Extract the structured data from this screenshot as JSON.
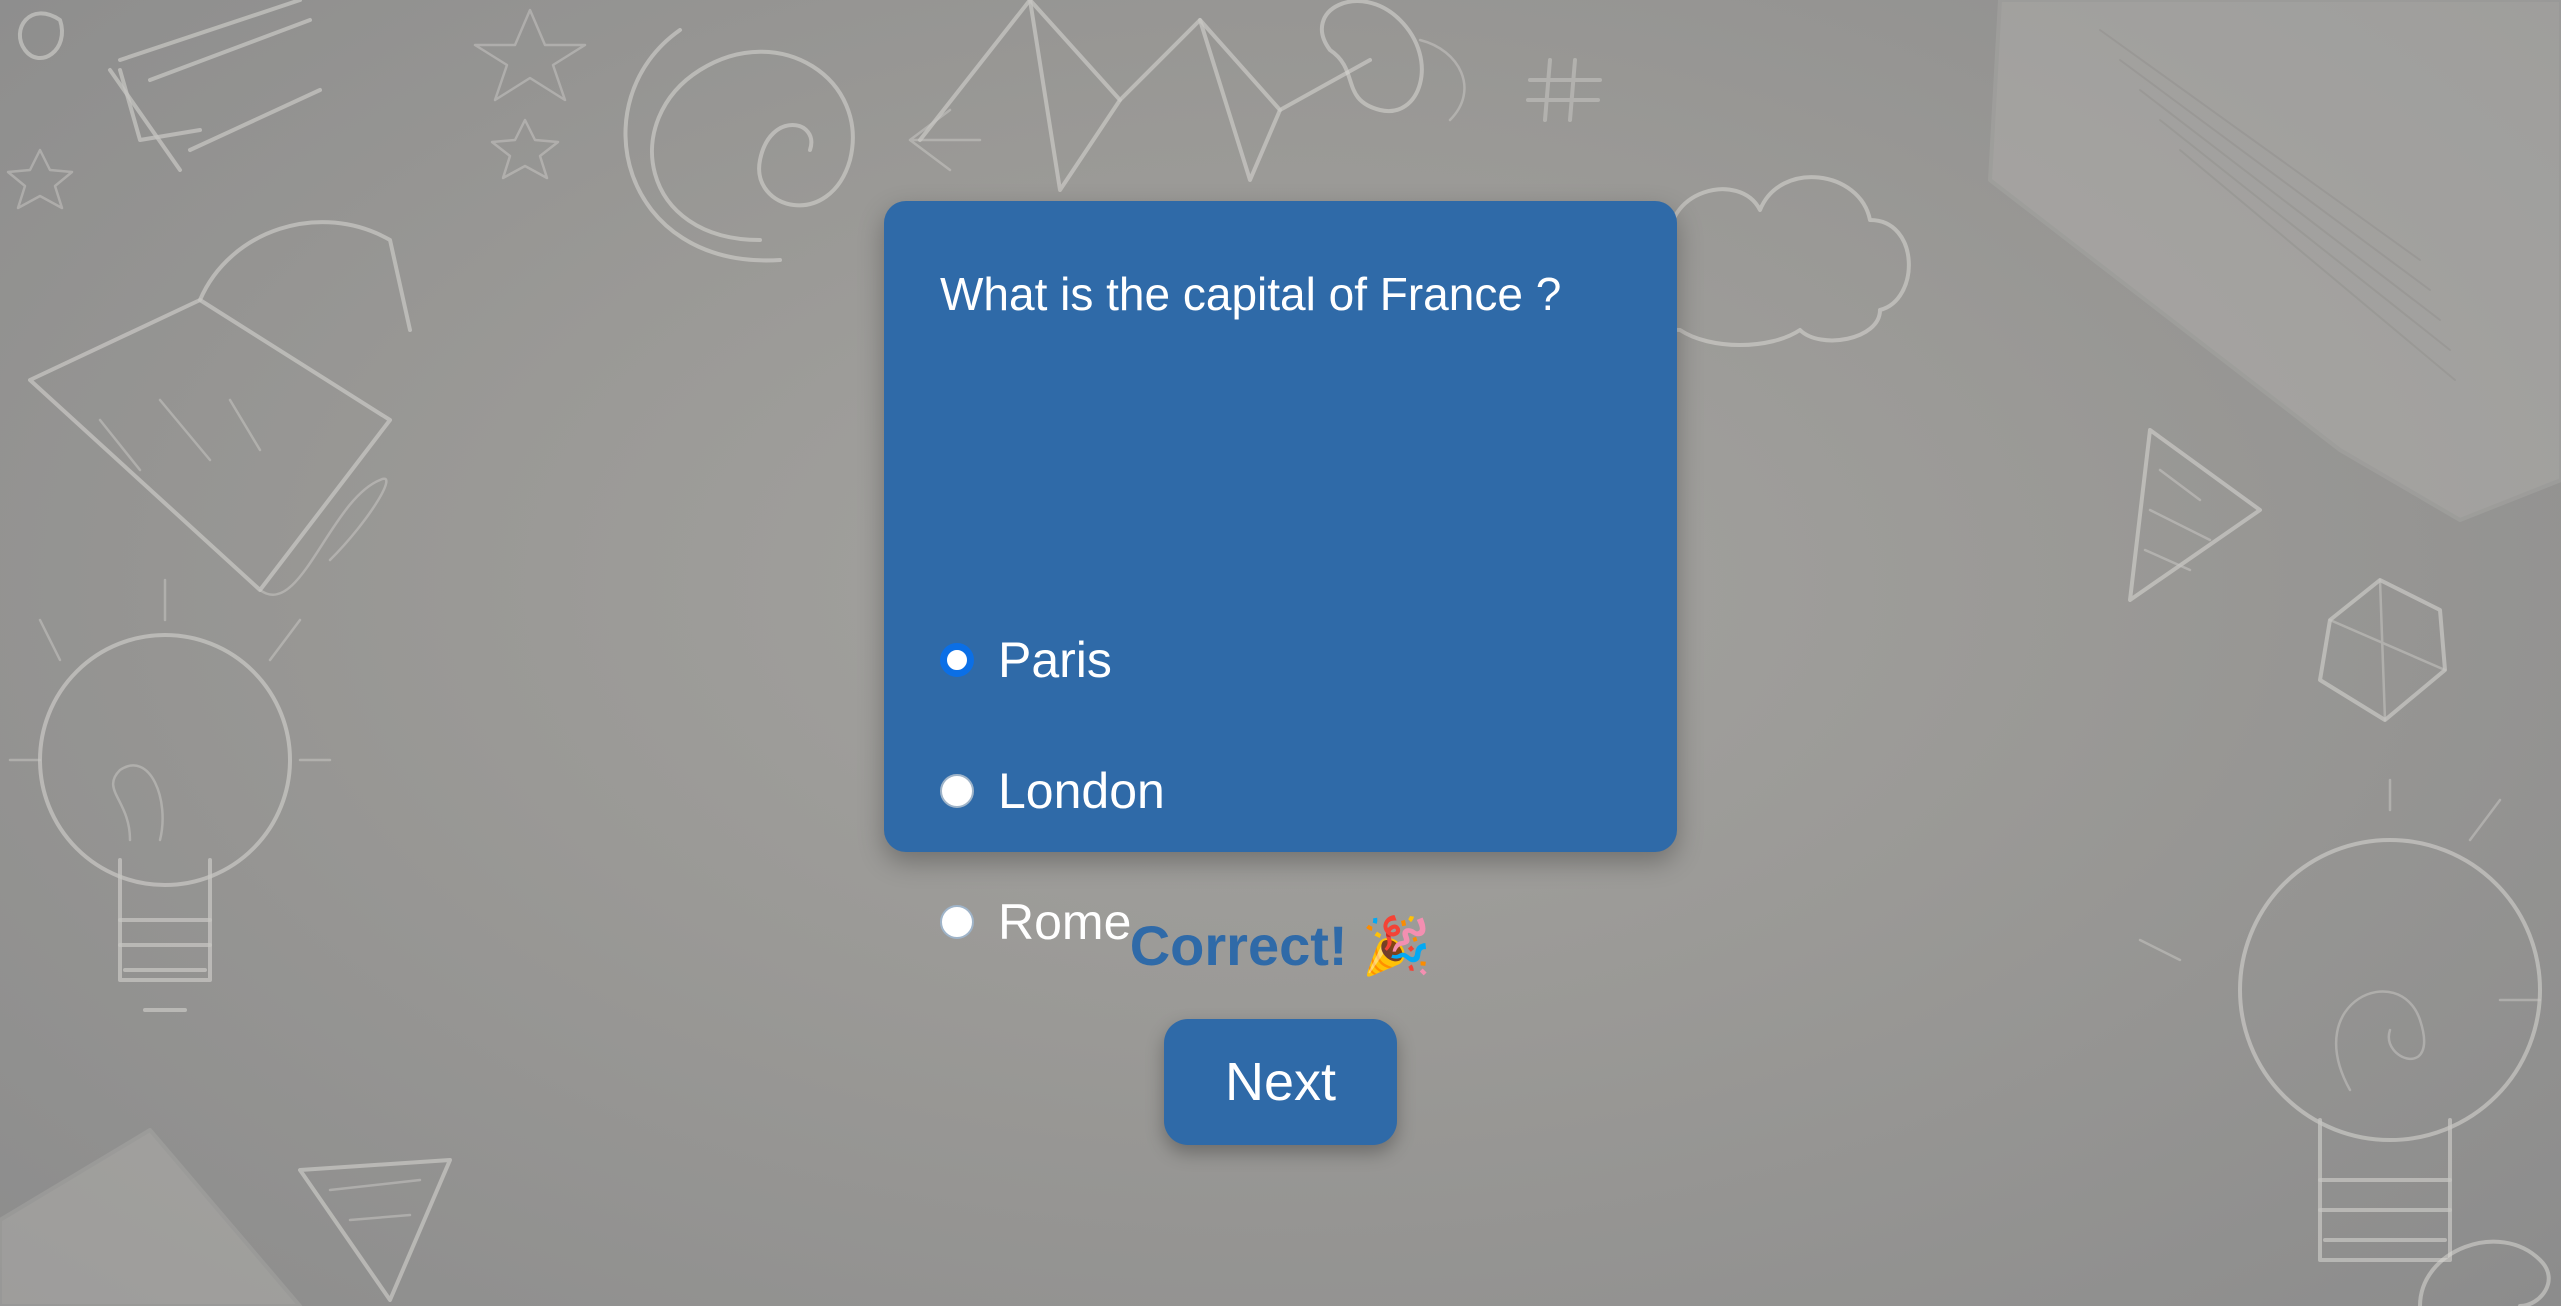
{
  "quiz": {
    "question": "What is the capital of France ?",
    "selected_option": "Paris",
    "options": [
      {
        "label": "Paris",
        "checked": true
      },
      {
        "label": "London",
        "checked": false
      },
      {
        "label": "Rome",
        "checked": false
      }
    ]
  },
  "feedback": {
    "text": "Correct!",
    "emoji": "🎉"
  },
  "actions": {
    "next_label": "Next"
  },
  "colors": {
    "card": "#2f6aa8",
    "selected_radio": "#0b6fe6",
    "text_on_card": "#ffffff",
    "feedback_text": "#2f6aa8"
  },
  "background": {
    "description_icons": [
      "lightbulb-icon",
      "star-icon",
      "cloud-icon",
      "kite-icon",
      "open-book-icon",
      "bunting-icon",
      "spiral-icon"
    ]
  }
}
